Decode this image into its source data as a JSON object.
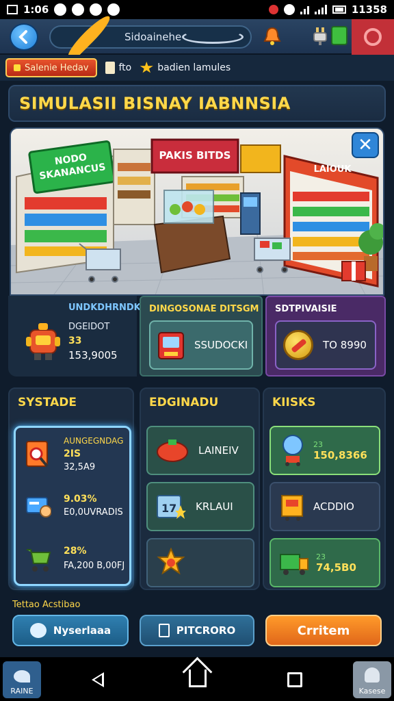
{
  "status_bar": {
    "time": "1:06",
    "clock_right": "11358",
    "icons": [
      "photo-icon",
      "circle-icon",
      "sync-icon",
      "flame-icon",
      "shield-icon",
      "alarm-icon",
      "wifi-icon",
      "signal-icon",
      "battery-icon"
    ]
  },
  "top_bar": {
    "search_text": "Sidoainehenais",
    "icons": [
      "back-arrow-icon",
      "location-pin-icon",
      "refresh-icon",
      "bell-icon",
      "plug-icon",
      "battery-icon",
      "power-icon"
    ],
    "accent_colors": {
      "back": "#1f7fd8",
      "power": "#c23038"
    }
  },
  "tabs": {
    "active_label": "Salenie Hedav",
    "item2_label": "fto",
    "item3_label": "badien lamules"
  },
  "title": "SIMULASII BISNAY IABNNSIA",
  "scene": {
    "sign_left": "NODO\nSKANANCUS",
    "sign_center": "PAKIS BITDS",
    "sign_right": "LAIOUK",
    "close_icon": "close-icon"
  },
  "stats": {
    "card1": {
      "title": "UNDKDHRNDK",
      "line1": "DGEIDOT",
      "line2": "33",
      "line3": "153,9005"
    },
    "card2": {
      "title": "DINGOSONAE DITSGM",
      "button_label": "SSUDOCKI"
    },
    "card3": {
      "title": "SDTPIVAISIE",
      "button_label": "TO 8990"
    }
  },
  "columns": {
    "left": {
      "title": "SYSTADE",
      "items": [
        {
          "t1": "AUNGEGNDAG",
          "t2": "2IS",
          "t3": "32,5A9",
          "icon": "search-card-icon"
        },
        {
          "t1": "",
          "t2": "9.03%",
          "t3": "E0,0UVRADIS",
          "icon": "card-hand-icon"
        },
        {
          "t1": "",
          "t2": "28%",
          "t3": "FA,200 B,00FJ",
          "icon": "shopping-cart-icon"
        }
      ]
    },
    "middle": {
      "title": "EDGINADU",
      "items": [
        {
          "label": "LAINEIV",
          "icon": "tomato-crate-icon"
        },
        {
          "label": "KRLAUI",
          "icon": "calendar-star-icon"
        },
        {
          "label": "",
          "icon": "badge-star-icon"
        }
      ]
    },
    "right": {
      "title": "KIISKS",
      "items": [
        {
          "sub": "23",
          "value": "150,8366",
          "icon": "balloon-stall-icon"
        },
        {
          "sub": "",
          "value": "ACDDIO",
          "icon": "kiosk-icon"
        },
        {
          "sub": "23",
          "value": "74,5B0",
          "icon": "truck-icon"
        }
      ]
    }
  },
  "footer": {
    "label": "Tettao Acstibao",
    "btn1": "Nyserlaaa",
    "btn2": "PITCRORO",
    "btn3": "Crritem"
  },
  "nav_bar": {
    "left_label": "RAINE",
    "right_label": "Kasese",
    "icons": [
      "back-icon",
      "home-icon",
      "recents-icon"
    ]
  }
}
